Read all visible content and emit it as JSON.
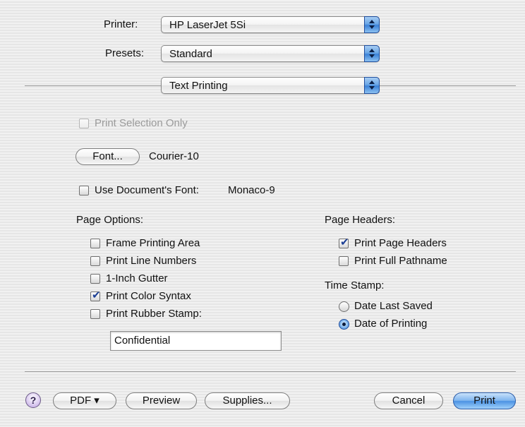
{
  "printer": {
    "label": "Printer:",
    "value": "HP LaserJet 5Si"
  },
  "presets": {
    "label": "Presets:",
    "value": "Standard"
  },
  "panel": {
    "value": "Text Printing"
  },
  "print_selection_only": {
    "label": "Print Selection Only",
    "checked": false,
    "enabled": false
  },
  "font": {
    "button_label": "Font...",
    "current": "Courier-10"
  },
  "use_doc_font": {
    "label": "Use Document's Font:",
    "font": "Monaco-9",
    "checked": false
  },
  "page_options": {
    "heading": "Page Options:",
    "items": [
      {
        "label": "Frame Printing Area",
        "checked": false
      },
      {
        "label": "Print Line Numbers",
        "checked": false
      },
      {
        "label": "1-Inch Gutter",
        "checked": false
      },
      {
        "label": "Print Color Syntax",
        "checked": true
      },
      {
        "label": "Print Rubber Stamp:",
        "checked": false
      }
    ],
    "stamp_text": "Confidential"
  },
  "page_headers": {
    "heading": "Page Headers:",
    "items": [
      {
        "label": "Print Page Headers",
        "checked": true
      },
      {
        "label": "Print Full Pathname",
        "checked": false
      }
    ]
  },
  "time_stamp": {
    "heading": "Time Stamp:",
    "options": [
      {
        "label": "Date Last Saved",
        "selected": false
      },
      {
        "label": "Date of Printing",
        "selected": true
      }
    ]
  },
  "buttons": {
    "help": "?",
    "pdf": "PDF ▾",
    "preview": "Preview",
    "supplies": "Supplies...",
    "cancel": "Cancel",
    "print": "Print"
  },
  "colors": {
    "accent": "#3b82d8",
    "separator": "#9b9b9b"
  }
}
